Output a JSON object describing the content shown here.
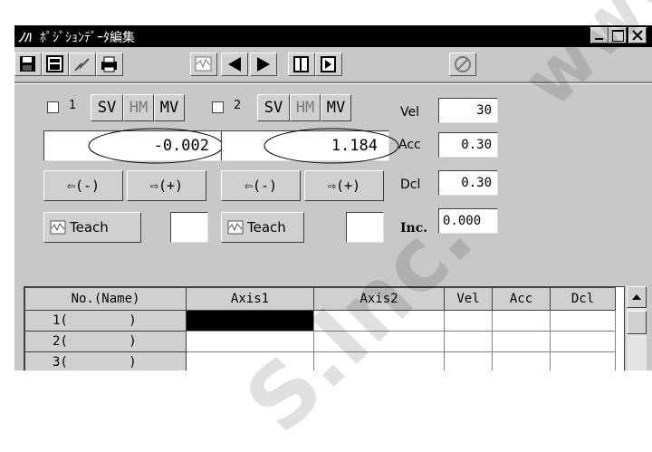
{
  "window": {
    "title_icon": "ﾉﾊ",
    "title": "ﾎﾟｼﾞｼｮﾝﾃﾞｰﾀ編集"
  },
  "toolbar": {
    "icons": [
      "save-icon",
      "device-icon",
      "flash-icon",
      "print-icon",
      "waveform-icon",
      "prev-icon",
      "next-icon",
      "page-icon",
      "page-forward-icon",
      "cancel-icon"
    ]
  },
  "axis1": {
    "number": "1",
    "sv_label": "SV",
    "hm_label": "HM",
    "mv_label": "MV",
    "value": "-0.002",
    "jog_minus": "⇦(-)",
    "jog_plus": "⇨(+)",
    "teach_label": "Teach"
  },
  "axis2": {
    "number": "2",
    "sv_label": "SV",
    "hm_label": "HM",
    "mv_label": "MV",
    "value": "1.184",
    "jog_minus": "⇦(-)",
    "jog_plus": "⇨(+)",
    "teach_label": "Teach"
  },
  "params": {
    "vel_label": "Vel",
    "vel_value": "30",
    "acc_label": "Acc",
    "acc_value": "0.30",
    "dcl_label": "Dcl",
    "dcl_value": "0.30",
    "inc_label": "Inc.",
    "inc_value": "0.000"
  },
  "table": {
    "columns": [
      "No.(Name)",
      "Axis1",
      "Axis2",
      "Vel",
      "Acc",
      "Dcl"
    ],
    "rows": [
      {
        "name": "1(        )"
      },
      {
        "name": "2(        )"
      },
      {
        "name": "3(        )"
      }
    ]
  },
  "watermark": {
    "text1": "www",
    "text2": "S.Inc."
  }
}
